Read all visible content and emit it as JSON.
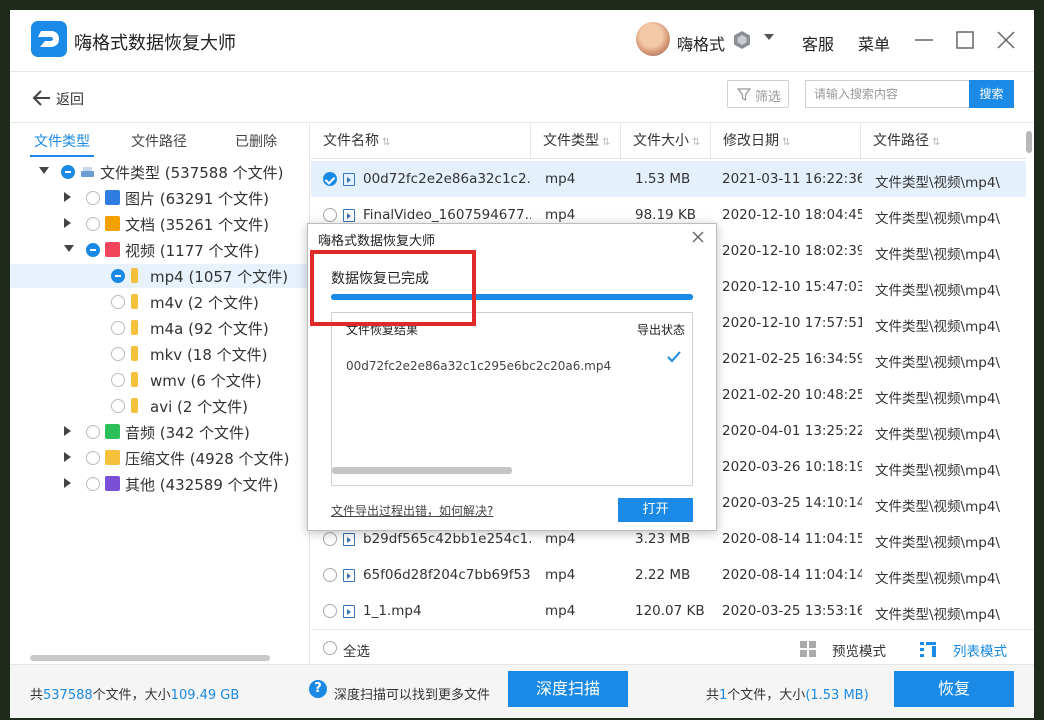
{
  "app": {
    "title": "嗨格式数据恢复大师",
    "username": "嗨格式",
    "service": "客服",
    "menu": "菜单"
  },
  "toolbar": {
    "back": "返回",
    "filter": "筛选",
    "search_placeholder": "请输入搜索内容",
    "search_button": "搜索"
  },
  "left_tabs": [
    "文件类型",
    "文件路径",
    "已删除"
  ],
  "tree": [
    {
      "label": "文件类型 (537588 个文件)",
      "color": "#6a9bd1"
    },
    {
      "label": "图片 (63291 个文件)",
      "color": "#2f7de0"
    },
    {
      "label": "文档 (35261 个文件)",
      "color": "#f4a000"
    },
    {
      "label": "视频 (1177 个文件)",
      "color": "#f0455a"
    },
    {
      "label": "mp4 (1057 个文件)",
      "color": "#f5c03c"
    },
    {
      "label": "m4v (2 个文件)",
      "color": "#f5c03c"
    },
    {
      "label": "m4a (92 个文件)",
      "color": "#f5c03c"
    },
    {
      "label": "mkv (18 个文件)",
      "color": "#f5c03c"
    },
    {
      "label": "wmv (6 个文件)",
      "color": "#f5c03c"
    },
    {
      "label": "avi (2 个文件)",
      "color": "#f5c03c"
    },
    {
      "label": "音频 (342 个文件)",
      "color": "#2dbf5a"
    },
    {
      "label": "压缩文件 (4928 个文件)",
      "color": "#f5c03c"
    },
    {
      "label": "其他 (432589 个文件)",
      "color": "#7a4fd6"
    }
  ],
  "columns": [
    "文件名称",
    "文件类型",
    "文件大小",
    "修改日期",
    "文件路径"
  ],
  "files": [
    {
      "name": "00d72fc2e2e86a32c1c2...",
      "type": "mp4",
      "size": "1.53 MB",
      "date": "2021-03-11 16:22:36",
      "path": "文件类型\\视频\\mp4\\"
    },
    {
      "name": "FinalVideo_1607594677....",
      "type": "mp4",
      "size": "98.19 KB",
      "date": "2020-12-10 18:04:45",
      "path": "文件类型\\视频\\mp4\\"
    },
    {
      "name": "",
      "type": "",
      "size": "",
      "date": "2020-12-10 18:02:39",
      "path": "文件类型\\视频\\mp4\\"
    },
    {
      "name": "",
      "type": "",
      "size": "",
      "date": "2020-12-10 15:47:03",
      "path": "文件类型\\视频\\mp4\\"
    },
    {
      "name": "",
      "type": "",
      "size": "",
      "date": "2020-12-10 17:57:51",
      "path": "文件类型\\视频\\mp4\\"
    },
    {
      "name": "",
      "type": "",
      "size": "",
      "date": "2021-02-25 16:34:59",
      "path": "文件类型\\视频\\mp4\\"
    },
    {
      "name": "",
      "type": "",
      "size": "",
      "date": "2021-02-20 10:48:25",
      "path": "文件类型\\视频\\mp4\\"
    },
    {
      "name": "",
      "type": "",
      "size": "",
      "date": "2020-04-01 13:25:22",
      "path": "文件类型\\视频\\mp4\\"
    },
    {
      "name": "",
      "type": "",
      "size": "",
      "date": "2020-03-26 10:18:19",
      "path": "文件类型\\视频\\mp4\\"
    },
    {
      "name": "",
      "type": "",
      "size": "",
      "date": "2020-03-25 14:10:14",
      "path": "文件类型\\视频\\mp4\\"
    },
    {
      "name": "b29df565c42bb1e254c1...",
      "type": "mp4",
      "size": "3.23 MB",
      "date": "2020-08-14 11:04:15",
      "path": "文件类型\\视频\\mp4\\"
    },
    {
      "name": "65f06d28f204c7bb69f53...",
      "type": "mp4",
      "size": "2.22 MB",
      "date": "2020-08-14 11:04:14",
      "path": "文件类型\\视频\\mp4\\"
    },
    {
      "name": "1_1.mp4",
      "type": "mp4",
      "size": "120.07 KB",
      "date": "2020-03-25 13:53:16",
      "path": "文件类型\\视频\\mp4\\"
    }
  ],
  "list_footer": {
    "select_all": "全选",
    "preview_mode": "预览模式",
    "list_mode": "列表模式"
  },
  "status": {
    "total_prefix": "共",
    "total_files": "537588",
    "total_mid": "个文件，大小",
    "total_size": "109.49 GB",
    "deep_hint": "深度扫描可以找到更多文件",
    "deep_button": "深度扫描",
    "sel_prefix": "共",
    "sel_count": "1",
    "sel_mid": "个文件，大小",
    "sel_size": "(1.53 MB)",
    "recover_button": "恢复"
  },
  "dialog": {
    "title": "嗨格式数据恢复大师",
    "message": "数据恢复已完成",
    "progress": 1.0,
    "result_header": "文件恢复结果",
    "status_header": "导出状态",
    "file": "00d72fc2e2e86a32c1c295e6bc2c20a6.mp4",
    "help_link": "文件导出过程出错，如何解决?",
    "open_button": "打开"
  },
  "colors": {
    "accent": "#1a8ae6",
    "highlight": "#e02a2a"
  }
}
